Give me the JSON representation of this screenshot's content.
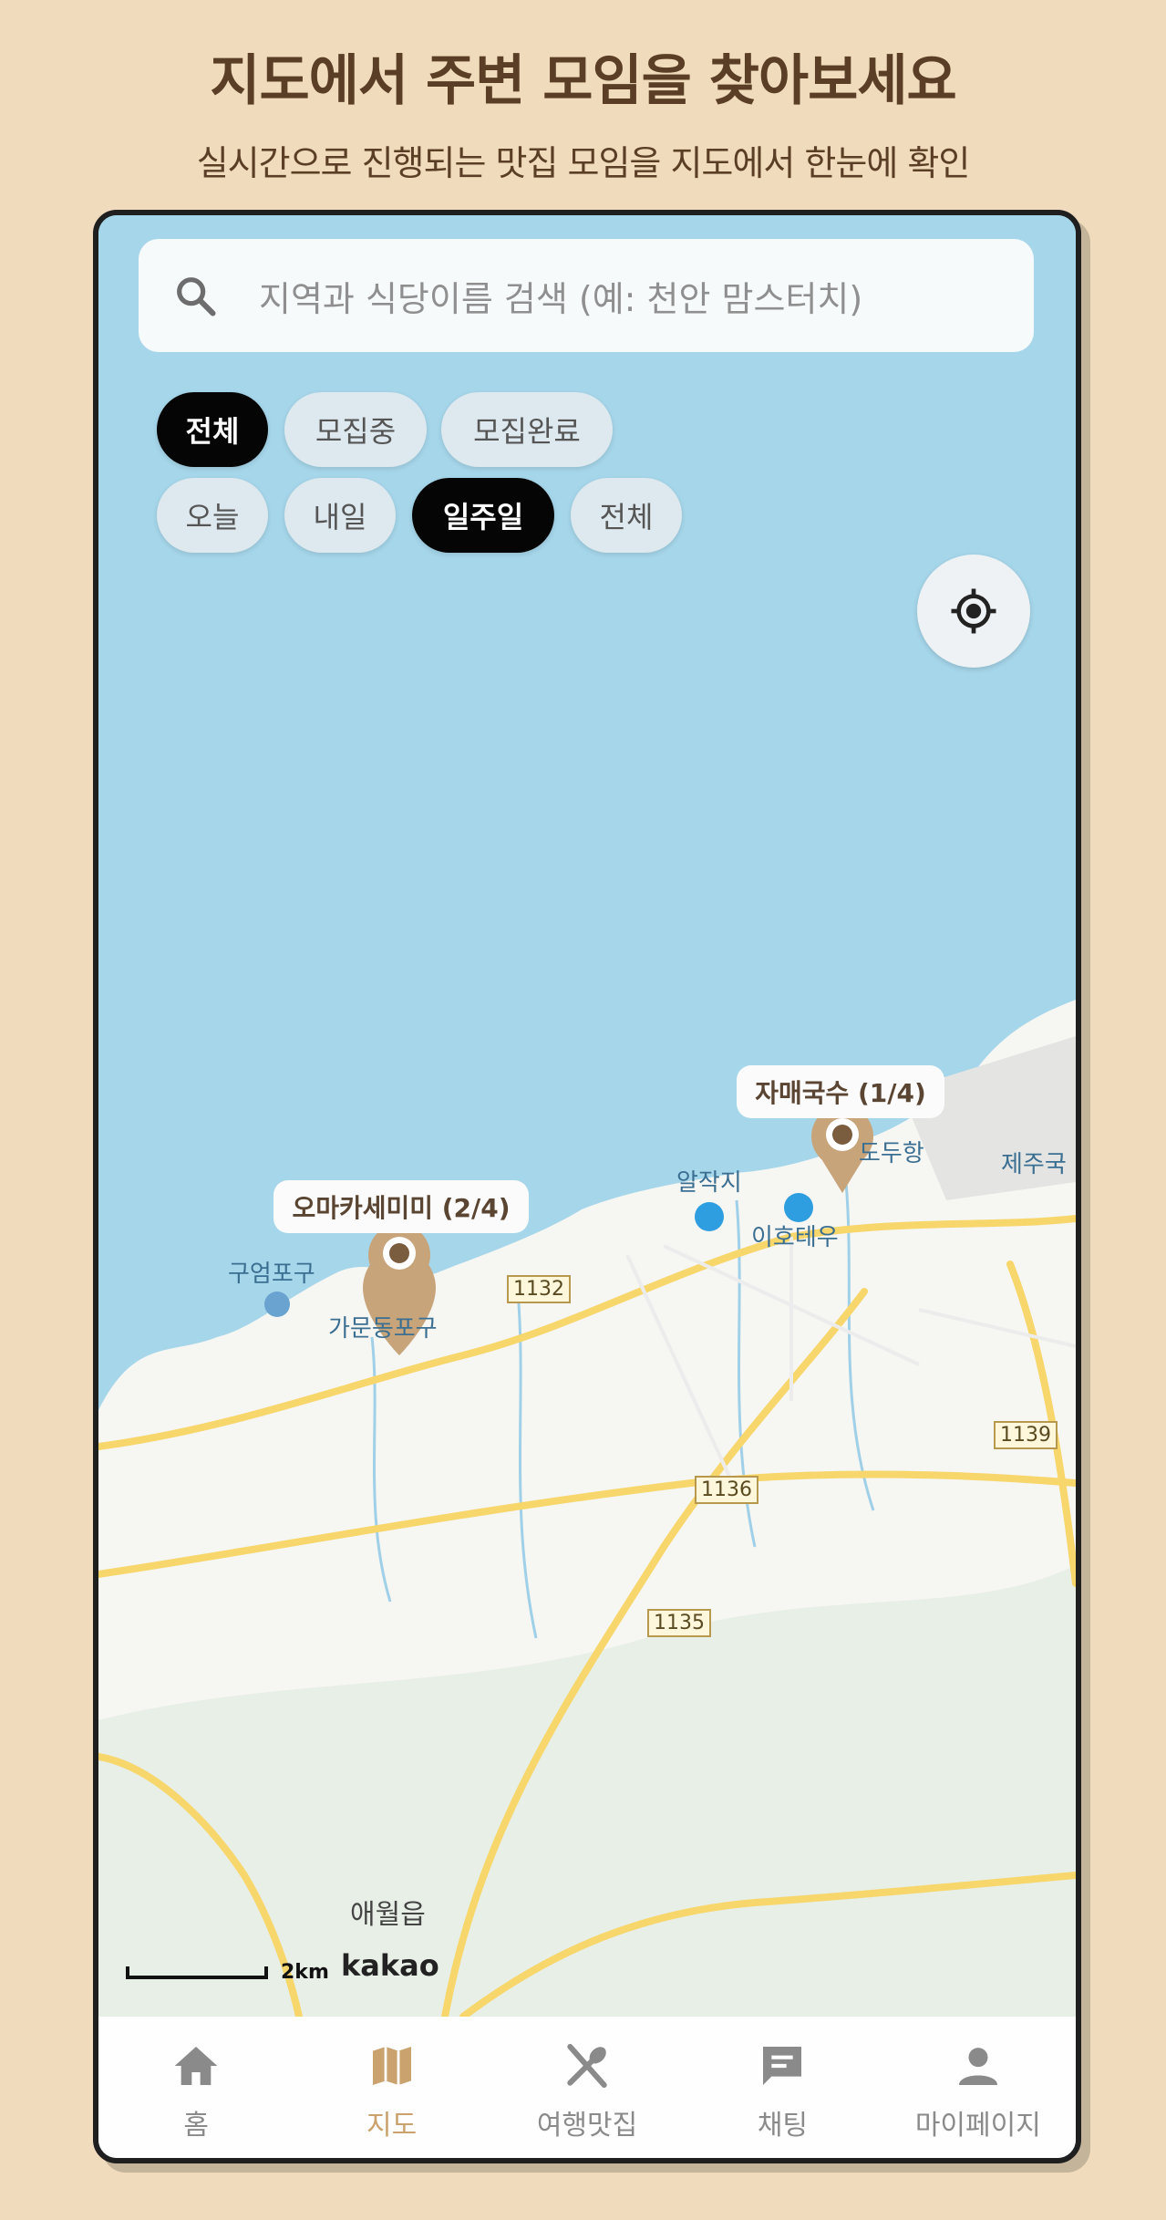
{
  "hero": {
    "title": "지도에서 주변 모임을 찾아보세요",
    "subtitle": "실시간으로 진행되는 맛집 모임을 지도에서 한눈에 확인"
  },
  "search": {
    "placeholder": "지역과 식당이름 검색 (예: 천안 맘스터치)",
    "icon": "search-icon"
  },
  "filters": {
    "status": [
      {
        "label": "전체",
        "selected": true
      },
      {
        "label": "모집중",
        "selected": false
      },
      {
        "label": "모집완료",
        "selected": false
      }
    ],
    "period": [
      {
        "label": "오늘",
        "selected": false
      },
      {
        "label": "내일",
        "selected": false
      },
      {
        "label": "일주일",
        "selected": true
      },
      {
        "label": "전체",
        "selected": false
      }
    ]
  },
  "markers": [
    {
      "label": "오마카세미미 (2/4)"
    },
    {
      "label": "자매국수 (1/4)"
    }
  ],
  "map": {
    "places": [
      "구엄포구",
      "가문동포구",
      "알작지",
      "이호테우",
      "도두항",
      "제주국",
      "애월읍"
    ],
    "roads": [
      "1132",
      "1136",
      "1135",
      "1139"
    ],
    "scale": "2km",
    "provider": "kakao",
    "colors": {
      "sea": "#a6d6ea",
      "land": "#f6f6f3",
      "road": "#f7d66b",
      "marker": "#c8a47a"
    }
  },
  "tabs": [
    {
      "label": "홈",
      "icon": "home-icon",
      "active": false
    },
    {
      "label": "지도",
      "icon": "map-icon",
      "active": true
    },
    {
      "label": "여행맛집",
      "icon": "utensils-icon",
      "active": false
    },
    {
      "label": "채팅",
      "icon": "chat-icon",
      "active": false
    },
    {
      "label": "마이페이지",
      "icon": "person-icon",
      "active": false
    }
  ]
}
